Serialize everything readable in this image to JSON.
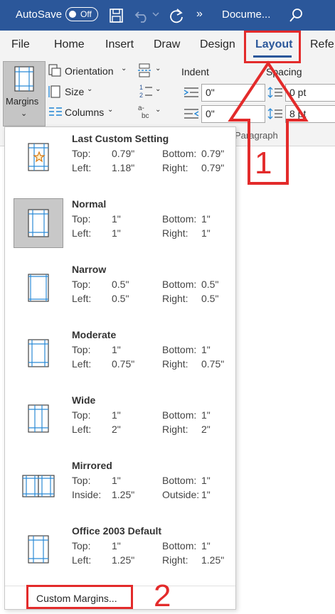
{
  "titlebar": {
    "autosave_label": "AutoSave",
    "autosave_state": "Off",
    "more_glyph": "»",
    "doc_title": "Docume..."
  },
  "tabs": [
    {
      "label": "File"
    },
    {
      "label": "Home"
    },
    {
      "label": "Insert"
    },
    {
      "label": "Draw"
    },
    {
      "label": "Design"
    },
    {
      "label": "Layout"
    },
    {
      "label": "Refe"
    }
  ],
  "ribbon": {
    "margins_label": "Margins",
    "orientation_label": "Orientation",
    "size_label": "Size",
    "columns_label": "Columns",
    "indent_label": "Indent",
    "spacing_label": "Spacing",
    "indent_left": "0\"",
    "indent_right": "0\"",
    "spacing_before": "0 pt",
    "spacing_after": "8 pt",
    "paragraph_label": "Paragraph"
  },
  "margin_options": [
    {
      "name": "Last Custom Setting",
      "r1a": "Top:",
      "r1b": "0.79\"",
      "r1c": "Bottom:",
      "r1d": "0.79\"",
      "r2a": "Left:",
      "r2b": "1.18\"",
      "r2c": "Right:",
      "r2d": "0.79\""
    },
    {
      "name": "Normal",
      "r1a": "Top:",
      "r1b": "1\"",
      "r1c": "Bottom:",
      "r1d": "1\"",
      "r2a": "Left:",
      "r2b": "1\"",
      "r2c": "Right:",
      "r2d": "1\""
    },
    {
      "name": "Narrow",
      "r1a": "Top:",
      "r1b": "0.5\"",
      "r1c": "Bottom:",
      "r1d": "0.5\"",
      "r2a": "Left:",
      "r2b": "0.5\"",
      "r2c": "Right:",
      "r2d": "0.5\""
    },
    {
      "name": "Moderate",
      "r1a": "Top:",
      "r1b": "1\"",
      "r1c": "Bottom:",
      "r1d": "1\"",
      "r2a": "Left:",
      "r2b": "0.75\"",
      "r2c": "Right:",
      "r2d": "0.75\""
    },
    {
      "name": "Wide",
      "r1a": "Top:",
      "r1b": "1\"",
      "r1c": "Bottom:",
      "r1d": "1\"",
      "r2a": "Left:",
      "r2b": "2\"",
      "r2c": "Right:",
      "r2d": "2\""
    },
    {
      "name": "Mirrored",
      "r1a": "Top:",
      "r1b": "1\"",
      "r1c": "Bottom:",
      "r1d": "1\"",
      "r2a": "Inside:",
      "r2b": "1.25\"",
      "r2c": "Outside:",
      "r2d": "1\""
    },
    {
      "name": "Office 2003 Default",
      "r1a": "Top:",
      "r1b": "1\"",
      "r1c": "Bottom:",
      "r1d": "1\"",
      "r2a": "Left:",
      "r2b": "1.25\"",
      "r2c": "Right:",
      "r2d": "1.25\""
    }
  ],
  "custom_margins_label": "Custom Margins...",
  "annotations": {
    "step1": "1",
    "step2": "2"
  },
  "colors": {
    "accent": "#2b579a",
    "annotation_red": "#e32b2b",
    "selected_bg": "#c8c8c8"
  }
}
